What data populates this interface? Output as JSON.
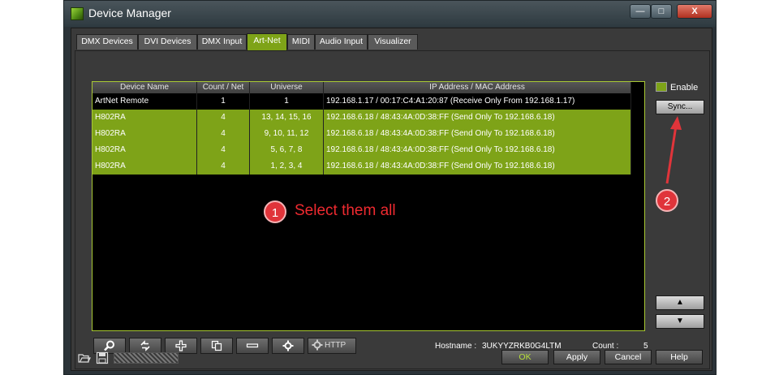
{
  "window": {
    "title": "Device Manager",
    "minimize": "—",
    "maximize": "□",
    "close": "X"
  },
  "tabs": [
    "DMX Devices",
    "DVI Devices",
    "DMX Input",
    "Art-Net",
    "MIDI",
    "Audio Input",
    "Visualizer"
  ],
  "active_tab": "Art-Net",
  "table": {
    "headers": [
      "Device Name",
      "Count / Net",
      "Universe",
      "IP Address / MAC Address"
    ],
    "rows": [
      {
        "name": "ArtNet Remote",
        "count": "1",
        "universe": "1",
        "ip": "192.168.1.17 / 00:17:C4:A1:20:87 (Receive Only From 192.168.1.17)",
        "selected": false
      },
      {
        "name": "H802RA",
        "count": "4",
        "universe": "13, 14, 15, 16",
        "ip": "192.168.6.18 / 48:43:4A:0D:38:FF (Send Only To 192.168.6.18)",
        "selected": true
      },
      {
        "name": "H802RA",
        "count": "4",
        "universe": "9, 10, 11, 12",
        "ip": "192.168.6.18 / 48:43:4A:0D:38:FF (Send Only To 192.168.6.18)",
        "selected": true
      },
      {
        "name": "H802RA",
        "count": "4",
        "universe": "5, 6, 7, 8",
        "ip": "192.168.6.18 / 48:43:4A:0D:38:FF (Send Only To 192.168.6.18)",
        "selected": true
      },
      {
        "name": "H802RA",
        "count": "4",
        "universe": "1, 2, 3, 4",
        "ip": "192.168.6.18 / 48:43:4A:0D:38:FF (Send Only To 192.168.6.18)",
        "selected": true
      }
    ]
  },
  "side": {
    "enable_label": "Enable",
    "sync_label": "Sync...",
    "up_label": "▲",
    "down_label": "▼"
  },
  "toolbar": {
    "icons": [
      "search-icon",
      "refresh-icon",
      "plus-icon",
      "copy-icon",
      "minus-icon",
      "gear-icon"
    ],
    "http_label": "HTTP"
  },
  "status": {
    "hostname_label": "Hostname :",
    "hostname_value": "3UKYYZRKB0G4LTM",
    "count_label": "Count :",
    "count_value": "5"
  },
  "buttons": {
    "ok": "OK",
    "apply": "Apply",
    "cancel": "Cancel",
    "help": "Help"
  },
  "annotations": {
    "step1_number": "1",
    "step1_text": "Select them all",
    "step2_number": "2",
    "color": "#e0343a"
  }
}
